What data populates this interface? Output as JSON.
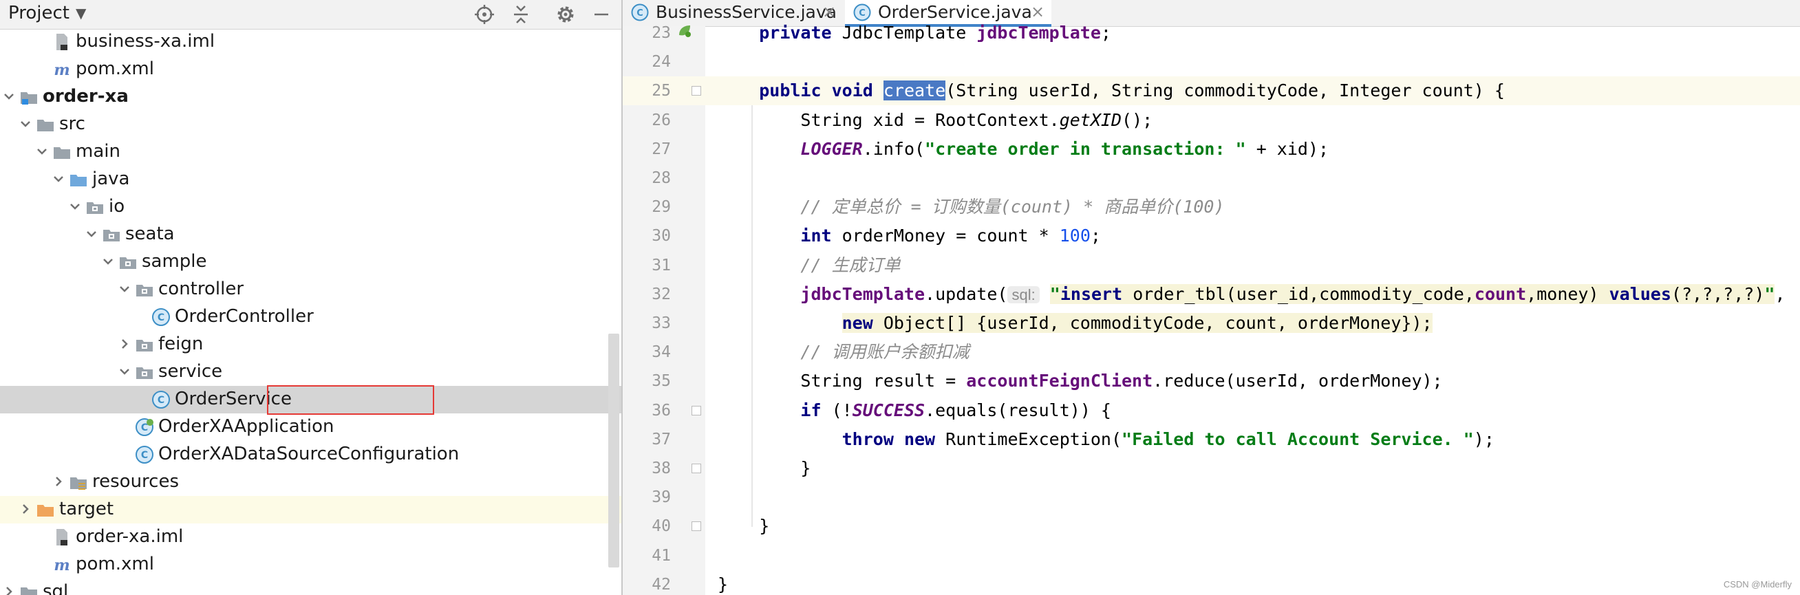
{
  "project_panel": {
    "title": "Project",
    "toolbar_icons": [
      "locate-icon",
      "collapse-all-icon",
      "gear-icon",
      "minimize-icon"
    ],
    "tree": [
      {
        "label": "business-xa.iml",
        "icon": "iml-file-icon",
        "arrow": "none"
      },
      {
        "label": "pom.xml",
        "icon": "maven-file-icon",
        "arrow": "none"
      },
      {
        "label": "order-xa",
        "icon": "module-folder-icon",
        "arrow": "down",
        "bold": true
      },
      {
        "label": "src",
        "icon": "folder-icon",
        "arrow": "down"
      },
      {
        "label": "main",
        "icon": "folder-icon",
        "arrow": "down"
      },
      {
        "label": "java",
        "icon": "source-folder-icon",
        "arrow": "down"
      },
      {
        "label": "io",
        "icon": "package-icon",
        "arrow": "down"
      },
      {
        "label": "seata",
        "icon": "package-icon",
        "arrow": "down"
      },
      {
        "label": "sample",
        "icon": "package-icon",
        "arrow": "down"
      },
      {
        "label": "controller",
        "icon": "package-icon",
        "arrow": "down"
      },
      {
        "label": "OrderController",
        "icon": "class-icon",
        "arrow": "none"
      },
      {
        "label": "feign",
        "icon": "package-icon",
        "arrow": "right"
      },
      {
        "label": "service",
        "icon": "package-icon",
        "arrow": "down"
      },
      {
        "label": "OrderService",
        "icon": "class-icon",
        "arrow": "none",
        "selected": true
      },
      {
        "label": "OrderXAApplication",
        "icon": "spring-class-icon",
        "arrow": "none"
      },
      {
        "label": "OrderXADataSourceConfiguration",
        "icon": "class-icon",
        "arrow": "none"
      },
      {
        "label": "resources",
        "icon": "resources-folder-icon",
        "arrow": "right"
      },
      {
        "label": "target",
        "icon": "excluded-folder-icon",
        "arrow": "right",
        "highlight": true
      },
      {
        "label": "order-xa.iml",
        "icon": "iml-file-icon",
        "arrow": "none"
      },
      {
        "label": "pom.xml",
        "icon": "maven-file-icon",
        "arrow": "none"
      },
      {
        "label": "sql",
        "icon": "folder-icon",
        "arrow": "right"
      }
    ]
  },
  "editor": {
    "tabs": [
      {
        "label": "BusinessService.java",
        "active": false
      },
      {
        "label": "OrderService.java",
        "active": true
      }
    ],
    "lines": [
      {
        "num": "23",
        "parts": [
          {
            "t": "    ",
            "c": ""
          },
          {
            "t": "private",
            "c": "kw"
          },
          {
            "t": " JdbcTemplate ",
            "c": ""
          },
          {
            "t": "jdbcTemplate",
            "c": "fld"
          },
          {
            "t": ";",
            "c": ""
          }
        ]
      },
      {
        "num": "24",
        "parts": []
      },
      {
        "num": "25",
        "parts": [
          {
            "t": "    ",
            "c": ""
          },
          {
            "t": "public",
            "c": "kw"
          },
          {
            "t": " ",
            "c": ""
          },
          {
            "t": "void",
            "c": "kw"
          },
          {
            "t": " ",
            "c": ""
          },
          {
            "t": "create",
            "c": "sel"
          },
          {
            "t": "(String userId, String commodityCode, Integer count) {",
            "c": ""
          }
        ]
      },
      {
        "num": "26",
        "parts": [
          {
            "t": "        String xid = RootContext.",
            "c": ""
          },
          {
            "t": "getXID",
            "c": "ital"
          },
          {
            "t": "();",
            "c": ""
          }
        ]
      },
      {
        "num": "27",
        "parts": [
          {
            "t": "        ",
            "c": ""
          },
          {
            "t": "LOGGER",
            "c": "sfld"
          },
          {
            "t": ".info(",
            "c": ""
          },
          {
            "t": "\"create order in transaction: \"",
            "c": "str"
          },
          {
            "t": " + xid);",
            "c": ""
          }
        ]
      },
      {
        "num": "28",
        "parts": []
      },
      {
        "num": "29",
        "parts": [
          {
            "t": "        ",
            "c": ""
          },
          {
            "t": "// 定单总价 = 订购数量(count) * 商品单价(100)",
            "c": "cmt"
          }
        ]
      },
      {
        "num": "30",
        "parts": [
          {
            "t": "        ",
            "c": ""
          },
          {
            "t": "int",
            "c": "kw"
          },
          {
            "t": " orderMoney = count * ",
            "c": ""
          },
          {
            "t": "100",
            "c": "num"
          },
          {
            "t": ";",
            "c": ""
          }
        ]
      },
      {
        "num": "31",
        "parts": [
          {
            "t": "        ",
            "c": ""
          },
          {
            "t": "// 生成订单",
            "c": "cmt"
          }
        ]
      },
      {
        "num": "32",
        "parts": [
          {
            "t": "        ",
            "c": ""
          },
          {
            "t": "jdbcTemplate",
            "c": "fld"
          },
          {
            "t": ".update(",
            "c": ""
          },
          {
            "t": "sql:",
            "c": "hint"
          },
          {
            "t": " ",
            "c": ""
          },
          {
            "t": "\"",
            "c": "str sqlbg"
          },
          {
            "t": "insert",
            "c": "sqlkw sqlbg"
          },
          {
            "t": " order_tbl(user_id,commodity_code,",
            "c": "sqlbg"
          },
          {
            "t": "count",
            "c": "sqlfld sqlbg"
          },
          {
            "t": ",money) ",
            "c": "sqlbg"
          },
          {
            "t": "values",
            "c": "sqlkw sqlbg"
          },
          {
            "t": "(?,?,?,?)",
            "c": "sqlbg"
          },
          {
            "t": "\"",
            "c": "str sqlbg"
          },
          {
            "t": ",",
            "c": ""
          }
        ]
      },
      {
        "num": "33",
        "parts": [
          {
            "t": "            ",
            "c": ""
          },
          {
            "t": "new",
            "c": "kw sqlbg"
          },
          {
            "t": " Object[] {userId, commodityCode, count, orderMoney});",
            "c": "sqlbg"
          }
        ]
      },
      {
        "num": "34",
        "parts": [
          {
            "t": "        ",
            "c": ""
          },
          {
            "t": "// 调用账户余额扣减",
            "c": "cmt"
          }
        ]
      },
      {
        "num": "35",
        "parts": [
          {
            "t": "        String result = ",
            "c": ""
          },
          {
            "t": "accountFeignClient",
            "c": "fld"
          },
          {
            "t": ".reduce(userId, orderMoney);",
            "c": ""
          }
        ]
      },
      {
        "num": "36",
        "parts": [
          {
            "t": "        ",
            "c": ""
          },
          {
            "t": "if",
            "c": "kw"
          },
          {
            "t": " (!",
            "c": ""
          },
          {
            "t": "SUCCESS",
            "c": "sfld"
          },
          {
            "t": ".equals(result)) {",
            "c": ""
          }
        ]
      },
      {
        "num": "37",
        "parts": [
          {
            "t": "            ",
            "c": ""
          },
          {
            "t": "throw",
            "c": "kw"
          },
          {
            "t": " ",
            "c": ""
          },
          {
            "t": "new",
            "c": "kw"
          },
          {
            "t": " RuntimeException(",
            "c": ""
          },
          {
            "t": "\"Failed to call Account Service. \"",
            "c": "str"
          },
          {
            "t": ");",
            "c": ""
          }
        ]
      },
      {
        "num": "38",
        "parts": [
          {
            "t": "        }",
            "c": ""
          }
        ]
      },
      {
        "num": "39",
        "parts": []
      },
      {
        "num": "40",
        "parts": [
          {
            "t": "    }",
            "c": ""
          }
        ]
      },
      {
        "num": "41",
        "parts": []
      },
      {
        "num": "42",
        "parts": [
          {
            "t": "}",
            "c": ""
          }
        ]
      }
    ],
    "caret_line": "25",
    "gutter_markers": {
      "23": "spring-bean-icon"
    }
  },
  "watermark": "CSDN @Miderfly",
  "colors": {
    "selection": "#4a79c4",
    "selected_row": "#d5d5d5",
    "tab_underline": "#4083c9",
    "sel_box": "#e53935"
  }
}
